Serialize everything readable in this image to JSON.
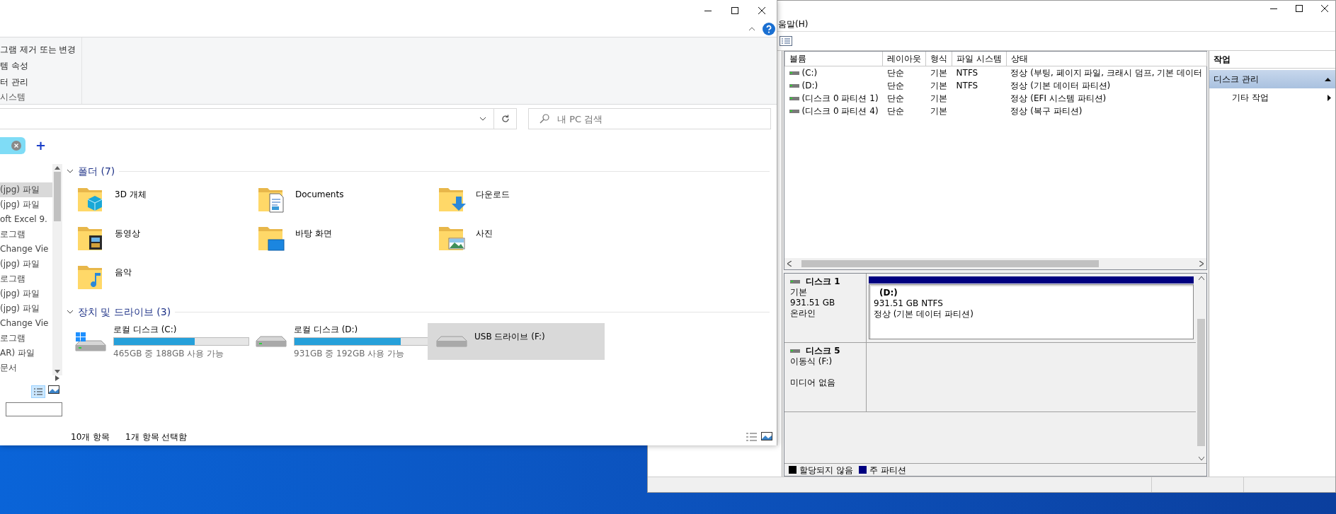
{
  "explorer": {
    "ribbon": {
      "items": [
        "그램 제거 또는 변경",
        "템 속성",
        "터 관리"
      ],
      "group": "시스템"
    },
    "search": {
      "placeholder": "내 PC 검색"
    },
    "tag_add": "+",
    "nav_items": [
      {
        "label": "(jpg) 파일",
        "selected": true
      },
      {
        "label": "(jpg) 파일",
        "selected": false
      },
      {
        "label": "oft Excel 9.",
        "selected": false
      },
      {
        "label": "로그램",
        "selected": false
      },
      {
        "label": "Change Vie",
        "selected": false
      },
      {
        "label": "(jpg) 파일",
        "selected": false
      },
      {
        "label": "로그램",
        "selected": false
      },
      {
        "label": "(jpg) 파일",
        "selected": false
      },
      {
        "label": "(jpg) 파일",
        "selected": false
      },
      {
        "label": "Change Vie",
        "selected": false
      },
      {
        "label": "로그램",
        "selected": false
      },
      {
        "label": "AR) 파일",
        "selected": false
      },
      {
        "label": "문서",
        "selected": false
      }
    ],
    "folders_header": {
      "title": "폴더 (7)",
      "expanded": true
    },
    "folders": [
      "3D 개체",
      "Documents",
      "다운로드",
      "동영상",
      "바탕 화면",
      "사진",
      "음악"
    ],
    "drives_header": {
      "title": "장치 및 드라이브 (3)",
      "expanded": true
    },
    "drives": [
      {
        "kind": "system",
        "name": "로컬 디스크 (C:)",
        "level": 0.6,
        "free": "465GB 중 188GB 사용 가능",
        "selected": false
      },
      {
        "kind": "local",
        "name": "로컬 디스크 (D:)",
        "level": 0.79,
        "free": "931GB 중 192GB 사용 가능",
        "selected": false
      },
      {
        "kind": "removable",
        "name": "USB 드라이브 (F:)",
        "selected": true
      }
    ],
    "status": [
      "10개 항목",
      "1개 항목 선택함"
    ]
  },
  "disk_management": {
    "menu": "움말(H)",
    "volume_table": {
      "columns": [
        "볼륨",
        "레이아웃",
        "형식",
        "파일 시스템",
        "상태"
      ],
      "rows": [
        {
          "volume": "(C:)",
          "layout": "단순",
          "type": "기본",
          "fs": "NTFS",
          "status": "정상 (부팅, 페이지 파일, 크래시 덤프, 기본 데이터"
        },
        {
          "volume": "(D:)",
          "layout": "단순",
          "type": "기본",
          "fs": "NTFS",
          "status": "정상 (기본 데이터 파티션)"
        },
        {
          "volume": "(디스크 0 파티션 1)",
          "layout": "단순",
          "type": "기본",
          "status": "정상 (EFI 시스템 파티션)"
        },
        {
          "volume": "(디스크 0 파티션 4)",
          "layout": "단순",
          "type": "기본",
          "status": "정상 (복구 파티션)"
        }
      ]
    },
    "disks": [
      {
        "name": "디스크 1",
        "type": "기본",
        "size": "931.51 GB",
        "state": "온라인",
        "partitions": [
          {
            "name": "(D:)",
            "size": "931.51 GB NTFS",
            "status": "정상 (기본 데이터 파티션)",
            "color": "#000080"
          }
        ]
      },
      {
        "name": "디스크 5",
        "type": "이동식 (F:)",
        "state": "미디어 없음"
      }
    ],
    "legend": [
      {
        "label": "할당되지 않음",
        "color": "#000000"
      },
      {
        "label": "주 파티션",
        "color": "#000080"
      }
    ],
    "actions": {
      "title": "작업",
      "items": [
        {
          "kind": "section",
          "label": "디스크 관리"
        },
        {
          "kind": "submenu",
          "label": "기타 작업"
        }
      ]
    }
  }
}
